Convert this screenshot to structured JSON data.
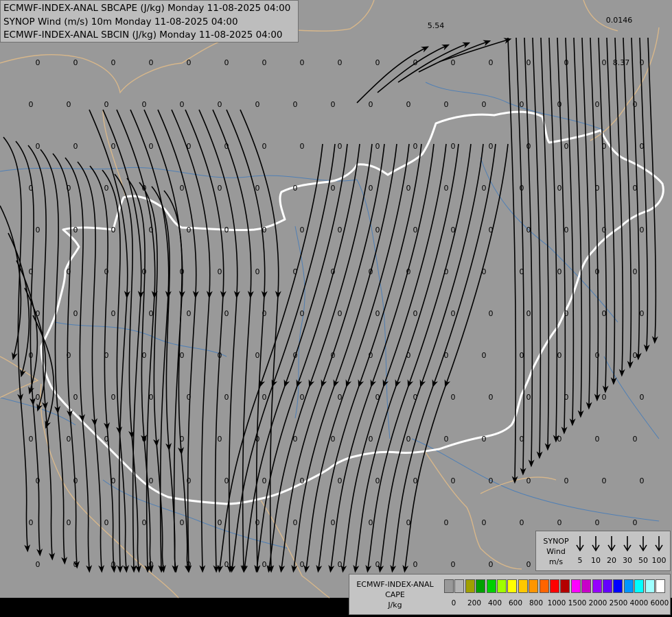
{
  "titles": {
    "line1": "ECMWF-INDEX-ANAL SBCAPE (J/kg) Monday 11-08-2025 04:00",
    "line2": "SYNOP Wind (m/s) 10m Monday 11-08-2025 04:00",
    "line3": "ECMWF-INDEX-ANAL SBCIN (J/kg) Monday 11-08-2025 04:00"
  },
  "map": {
    "background_color": "#999999",
    "border_color": "#ffffff",
    "neighbor_border_color": "#d8b78a",
    "river_color": "#4f7fb5",
    "streamline_color": "#000000",
    "special_values": [
      "5.54",
      "0.0146",
      "8.37"
    ]
  },
  "wind_legend": {
    "title": [
      "SYNOP",
      "Wind",
      "m/s"
    ],
    "speeds": [
      "5",
      "10",
      "20",
      "30",
      "50",
      "100"
    ]
  },
  "cape_legend": {
    "title": [
      "ECMWF-INDEX-ANAL",
      "CAPE",
      "J/kg"
    ],
    "ticks": [
      "0",
      "200",
      "400",
      "600",
      "800",
      "1000",
      "1500",
      "2000",
      "2500",
      "4000",
      "6000"
    ],
    "colors": [
      "#999999",
      "#b4b4b4",
      "#a0a000",
      "#00a000",
      "#00d000",
      "#a0ff00",
      "#ffff00",
      "#ffc800",
      "#ff9600",
      "#ff6400",
      "#ff0000",
      "#b40000",
      "#ff00ff",
      "#c800c8",
      "#9600ff",
      "#6400ff",
      "#0000ff",
      "#0096ff",
      "#00ffff",
      "#a0ffff",
      "#ffffff"
    ]
  }
}
